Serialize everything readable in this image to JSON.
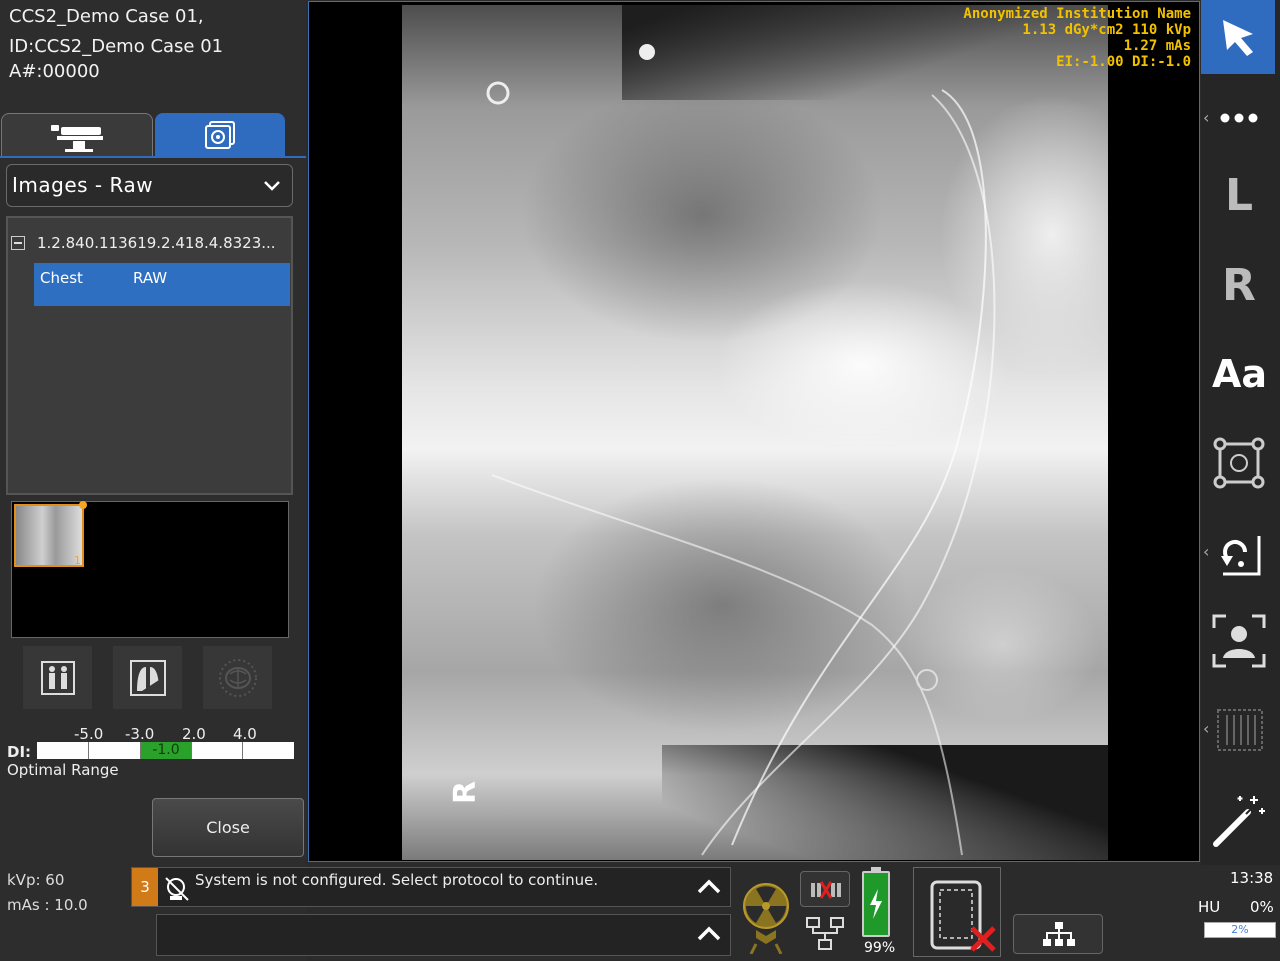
{
  "patient": {
    "name_line": "CCS2_Demo Case 01,",
    "id_line": "ID:CCS2_Demo Case 01",
    "accession_line": "A#:00000"
  },
  "left_tabs": {
    "tab1_icon": "patient-table-icon",
    "tab2_icon": "image-viewer-icon"
  },
  "image_set_dropdown": {
    "selected": "Images - Raw"
  },
  "series": {
    "uid": "1.2.840.113619.2.418.4.8323...",
    "selected_item": {
      "body_part": "Chest",
      "type": "RAW"
    },
    "thumbnail_count": "1"
  },
  "di": {
    "label": "DI:",
    "ticks": [
      "-5.0",
      "-3.0",
      "2.0",
      "4.0"
    ],
    "value": "-1.0",
    "range_text": "Optimal Range"
  },
  "close_button": "Close",
  "technique": {
    "kvp": "kVp: 60",
    "mas": "mAs : 10.0"
  },
  "overlay": {
    "institution": "Anonymized Institution Name",
    "dose_kvp": "1.13 dGy*cm2  110 kVp",
    "mas": "1.27 mAs",
    "ei_di": "EI:-1.00 DI:-1.0"
  },
  "image_marker": "R",
  "right_toolbar": {
    "items": [
      "select-arrow-icon",
      "more-icon",
      "L",
      "R",
      "Aa",
      "roi-icon",
      "rotate-icon",
      "recapture-icon",
      "grid-icon",
      "magic-wand-icon"
    ],
    "l_label": "L",
    "r_label": "R",
    "text_label": "Aa"
  },
  "messages": {
    "count": "3",
    "text": "System is not configured. Select protocol to continue."
  },
  "status": {
    "battery": "99%",
    "time": "13:38",
    "hu_label": "HU",
    "hu_value": "0%",
    "bar_value": "2%"
  },
  "colors": {
    "accent_blue": "#2f6cc0",
    "overlay_yellow": "#f2c200",
    "di_green": "#2aa12a",
    "alert_orange": "#d07a18",
    "error_red": "#e02020"
  }
}
